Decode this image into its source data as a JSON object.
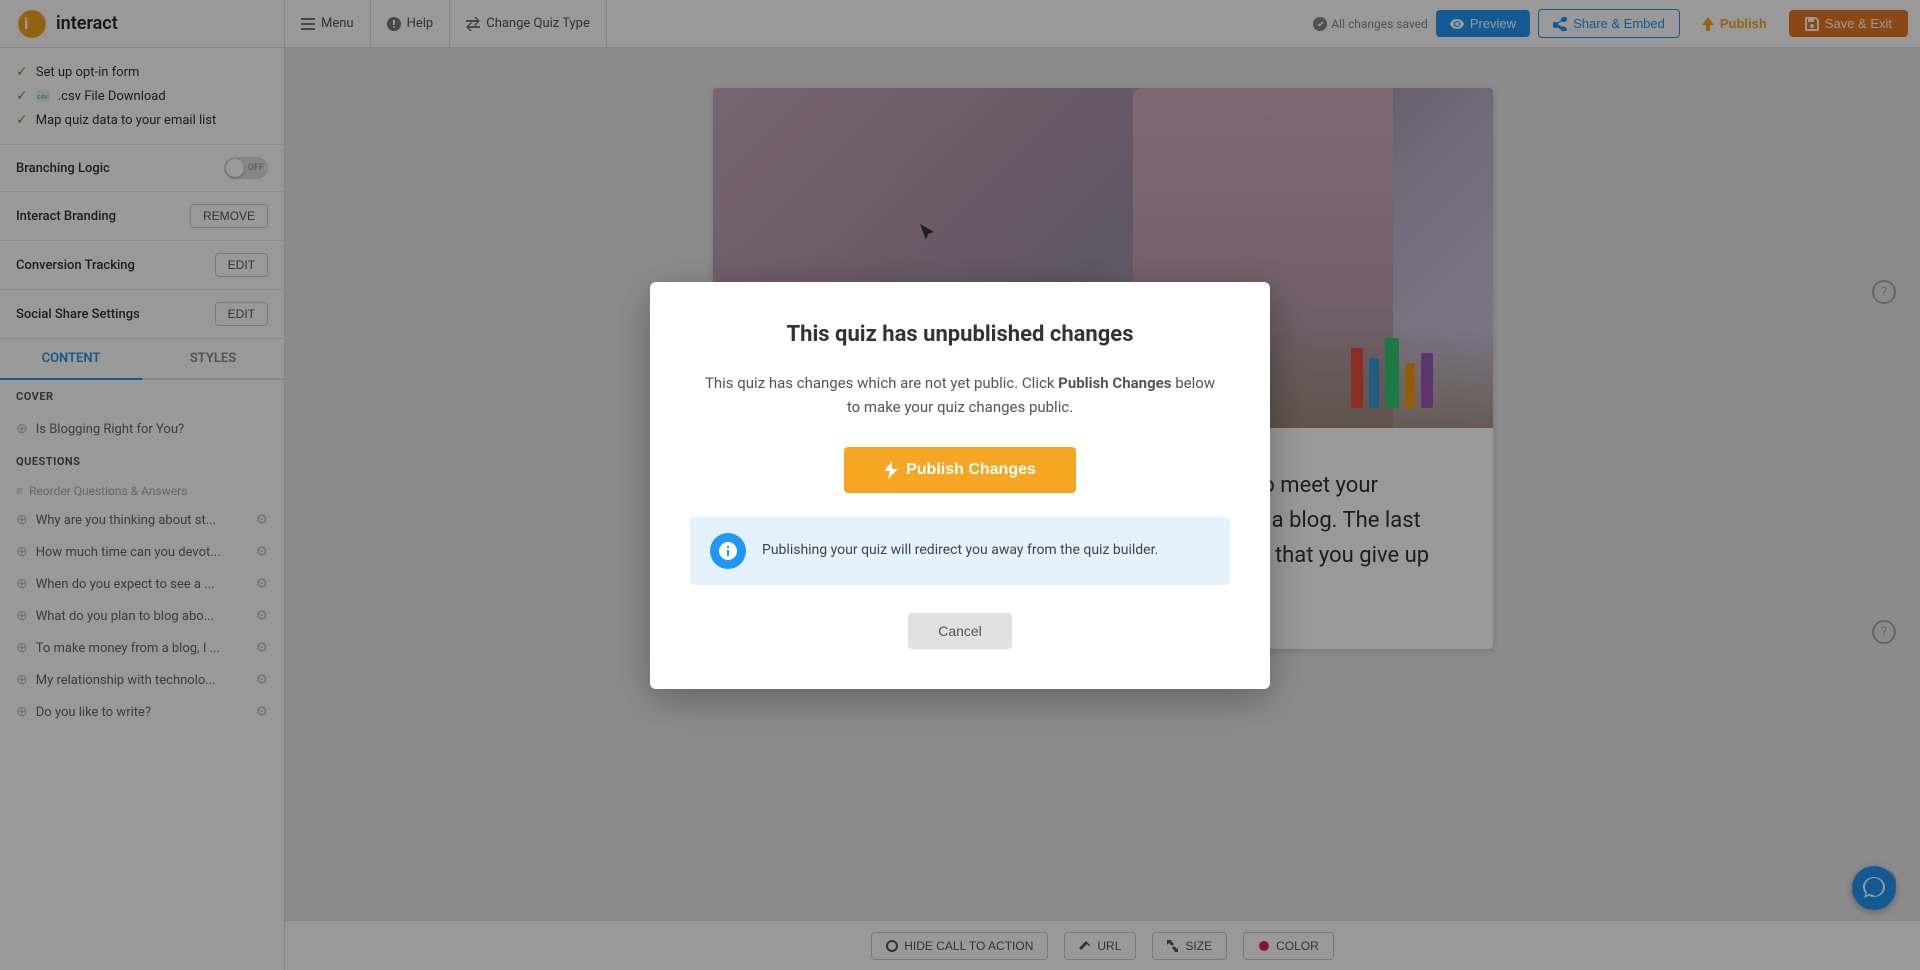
{
  "app": {
    "logo_text": "interact",
    "nav_items": [
      {
        "label": "Menu",
        "icon": "menu"
      },
      {
        "label": "Help",
        "icon": "help"
      },
      {
        "label": "Change Quiz Type",
        "icon": "swap"
      }
    ],
    "status": "All changes saved",
    "btn_preview": "Preview",
    "btn_share": "Share & Embed",
    "btn_publish_nav": "Publish",
    "btn_save": "Save & Exit"
  },
  "sidebar": {
    "setup_items": [
      {
        "label": "Set up opt-in form",
        "checked": true
      },
      {
        "label": ".csv File Download",
        "checked": true
      },
      {
        "label": "Map quiz data to your email list",
        "checked": true
      }
    ],
    "branching_logic": {
      "label": "Branching Logic",
      "state": "OFF"
    },
    "interact_branding": {
      "label": "Interact Branding",
      "btn_label": "REMOVE"
    },
    "conversion_tracking": {
      "label": "Conversion Tracking",
      "btn_label": "EDIT"
    },
    "social_share": {
      "label": "Social Share Settings",
      "btn_label": "EDIT"
    },
    "tabs": [
      {
        "label": "CONTENT",
        "active": true
      },
      {
        "label": "STYLES",
        "active": false
      }
    ],
    "cover_section": "COVER",
    "cover_item": "Is Blogging Right for You?",
    "questions_section": "QUESTIONS",
    "reorder_label": "Reorder Questions & Answers",
    "questions": [
      {
        "text": "Why are you thinking about st..."
      },
      {
        "text": "How much time can you devot..."
      },
      {
        "text": "When do you expect to see a ..."
      },
      {
        "text": "What do you plan to blog abo..."
      },
      {
        "text": "To make money from a blog, I ..."
      },
      {
        "text": "My relationship with technolo..."
      },
      {
        "text": "Do you like to write?"
      }
    ]
  },
  "modal": {
    "title_plain": "This quiz has ",
    "title_bold": "unpublished changes",
    "desc_plain1": "This quiz has changes which are not yet public. Click ",
    "desc_bold": "Publish Changes",
    "desc_plain2": " below",
    "desc_plain3": "to make your quiz changes public.",
    "btn_publish": "Publish Changes",
    "info_text": "Publishing your quiz will redirect you away from the quiz builder.",
    "btn_cancel": "Cancel"
  },
  "quiz_preview": {
    "body_text": "I hate to be harsh - but you either need to get a job to meet your immediate needs or revaluate why you want to start a blog. The last thing you want to do is waste your time on a venture that you give up on."
  },
  "toolbar": {
    "buttons": [
      {
        "label": "HIDE CALL TO ACTION"
      },
      {
        "label": "URL"
      },
      {
        "label": "SIZE"
      },
      {
        "label": "COLOR"
      }
    ]
  }
}
